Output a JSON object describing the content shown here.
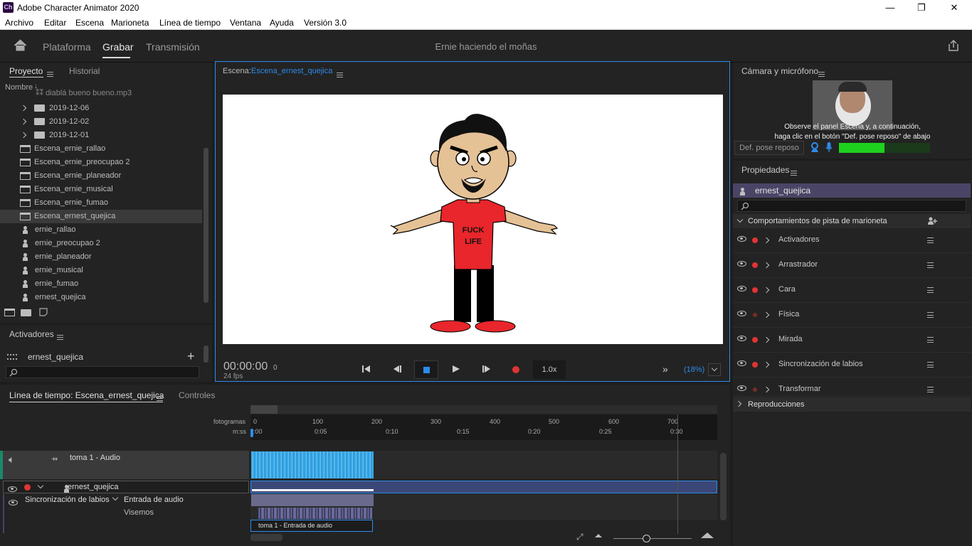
{
  "app": {
    "logo": "Ch",
    "title": "Adobe Character Animator 2020"
  },
  "window_buttons": {
    "minimize": "—",
    "maximize": "❐",
    "close": "✕"
  },
  "menu": [
    "Archivo",
    "Editar",
    "Escena",
    "Marioneta",
    "Línea de tiempo",
    "Ventana",
    "Ayuda",
    "Versión 3.0"
  ],
  "workspace": {
    "tabs": [
      "Plataforma",
      "Grabar",
      "Transmisión"
    ],
    "active": "Grabar",
    "doc_title": "Ernie haciendo el moñas"
  },
  "project_panel": {
    "tabs": [
      "Proyecto",
      "Historial"
    ],
    "column": "Nombre",
    "items": [
      {
        "type": "audio",
        "label": "diablá bueno bueno.mp3"
      },
      {
        "type": "folder",
        "label": "2019-12-06"
      },
      {
        "type": "folder",
        "label": "2019-12-02"
      },
      {
        "type": "folder",
        "label": "2019-12-01"
      },
      {
        "type": "scene",
        "label": "Escena_ernie_rallao"
      },
      {
        "type": "scene",
        "label": "Escena_ernie_preocupao 2"
      },
      {
        "type": "scene",
        "label": "Escena_ernie_planeador"
      },
      {
        "type": "scene",
        "label": "Escena_ernie_musical"
      },
      {
        "type": "scene",
        "label": "Escena_ernie_fumao"
      },
      {
        "type": "scene",
        "label": "Escena_ernest_quejica",
        "selected": true
      },
      {
        "type": "puppet",
        "label": "ernie_rallao"
      },
      {
        "type": "puppet",
        "label": "ernie_preocupao 2"
      },
      {
        "type": "puppet",
        "label": "ernie_planeador"
      },
      {
        "type": "puppet",
        "label": "ernie_musical"
      },
      {
        "type": "puppet",
        "label": "ernie_fumao"
      },
      {
        "type": "puppet",
        "label": "ernest_quejica"
      }
    ]
  },
  "triggers_panel": {
    "title": "Activadores",
    "puppet": "ernest_quejica",
    "add": "+"
  },
  "scene_panel": {
    "label": "Escena:",
    "scene_name": "Escena_ernest_quejica",
    "shirt_text": [
      "FUCK",
      "LIFE"
    ],
    "timecode": "00:00:00",
    "frame": "0",
    "fps": "24 fps",
    "speed": "1.0x",
    "zoom": "(18%)"
  },
  "camera_panel": {
    "title": "Cámara y micrófono",
    "hint_line1": "Observe el panel Escena y, a continuación,",
    "hint_line2": "haga clic en el botón \"Def. pose reposo\" de abajo",
    "rest_pose_button": "Def. pose reposo",
    "mic_level": 0.5
  },
  "properties_panel": {
    "title": "Propiedades",
    "puppet": "ernest_quejica",
    "section": "Comportamientos de pista de marioneta",
    "behaviors": [
      {
        "name": "Activadores",
        "armed": true
      },
      {
        "name": "Arrastrador",
        "armed": true
      },
      {
        "name": "Cara",
        "armed": true
      },
      {
        "name": "Física",
        "armed": false
      },
      {
        "name": "Mirada",
        "armed": true
      },
      {
        "name": "Sincronización de labios",
        "armed": true
      },
      {
        "name": "Transformar",
        "armed": false
      }
    ],
    "replays": "Reproducciones"
  },
  "timeline": {
    "tabs": [
      "Línea de tiempo: Escena_ernest_quejica",
      "Controles"
    ],
    "frames_label": "fotogramas",
    "time_label": "m:ss",
    "frame_ticks": [
      "0",
      "100",
      "200",
      "300",
      "400",
      "500",
      "600",
      "700"
    ],
    "time_ticks": [
      ":00",
      "0:05",
      "0:10",
      "0:15",
      "0:20",
      "0:25",
      "0:30"
    ],
    "audio_track": "toma 1 - Audio",
    "puppet_track": "ernest_quejica",
    "lipsync": "Sincronización de labios",
    "input": "Entrada de audio",
    "visemes": "Visemos",
    "take": "toma 1 - Entrada de audio"
  },
  "colors": {
    "accent": "#2d8ceb",
    "record": "#e03434",
    "shirt": "#e8262b",
    "level": "#1ed11e"
  }
}
